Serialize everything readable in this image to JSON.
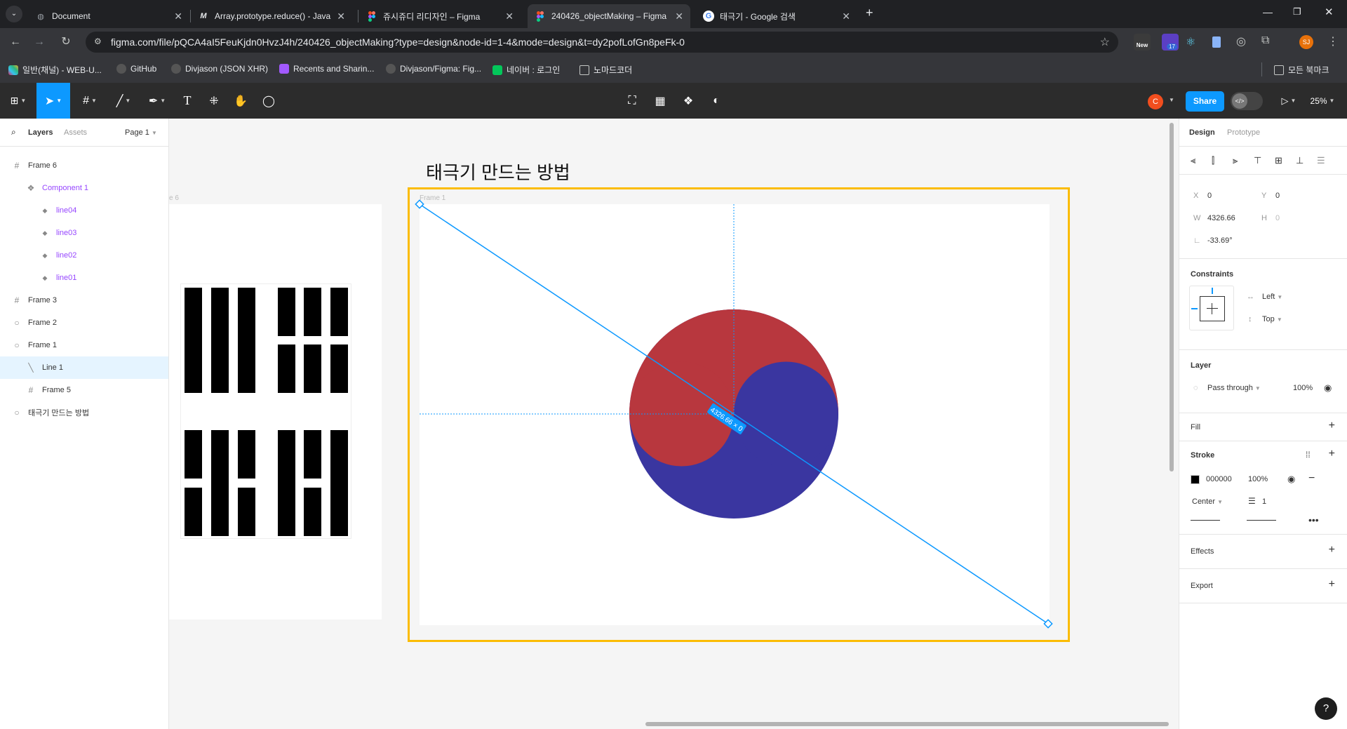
{
  "browser": {
    "tabs": [
      {
        "title": "Document",
        "icon": "globe-icon"
      },
      {
        "title": "Array.prototype.reduce() - Java",
        "icon": "mdn-icon"
      },
      {
        "title": "쥬시쥬디 리디자인 – Figma",
        "icon": "figma-icon"
      },
      {
        "title": "240426_objectMaking – Figma",
        "icon": "figma-icon"
      },
      {
        "title": "태극기 - Google 검색",
        "icon": "google-icon"
      }
    ],
    "new_tab": "+",
    "url": "figma.com/file/pQCA4aI5FeuKjdn0HvzJ4h/240426_objectMaking?type=design&node-id=1-4&mode=design&t=dy2pofLofGn8peFk-0",
    "bookmarks": [
      "일반(채널) - WEB-U...",
      "GitHub",
      "Divjason (JSON XHR)",
      "Recents and Sharin...",
      "Divjason/Figma: Fig...",
      "네이버 : 로그인",
      "노마드코더"
    ],
    "all_bookmarks": "모든 북마크",
    "ext_new": "New",
    "ext_badge": "17",
    "profile": "SJ"
  },
  "toolbar": {
    "avatar": "C",
    "share": "Share",
    "zoom": "25%"
  },
  "left_panel": {
    "tab_layers": "Layers",
    "tab_assets": "Assets",
    "page": "Page 1",
    "layers": [
      {
        "name": "Frame 6",
        "icon": "frame-icon",
        "indent": 0
      },
      {
        "name": "Component 1",
        "icon": "component-icon",
        "indent": 1
      },
      {
        "name": "line04",
        "icon": "instance-icon",
        "indent": 2
      },
      {
        "name": "line03",
        "icon": "instance-icon",
        "indent": 2
      },
      {
        "name": "line02",
        "icon": "instance-icon",
        "indent": 2
      },
      {
        "name": "line01",
        "icon": "instance-icon",
        "indent": 2
      },
      {
        "name": "Frame 3",
        "icon": "frame-icon",
        "indent": 0
      },
      {
        "name": "Frame 2",
        "icon": "ellipse-icon",
        "indent": 0
      },
      {
        "name": "Frame 1",
        "icon": "ellipse-icon",
        "indent": 0
      },
      {
        "name": "Line 1",
        "icon": "line-icon",
        "indent": 1
      },
      {
        "name": "Frame 5",
        "icon": "frame-icon",
        "indent": 1
      },
      {
        "name": "태극기 만드는 방법",
        "icon": "ellipse-icon",
        "indent": 0
      }
    ]
  },
  "canvas": {
    "heading": "태극기 만드는 방법",
    "frame1_label": "Frame 1",
    "frame6_label": "e 6",
    "measure": "4326.66 × 0",
    "colors": {
      "red": "#b8373e",
      "blue": "#3a36a0",
      "selection": "#fbbc04",
      "line": "#0d99ff"
    }
  },
  "right_panel": {
    "tab_design": "Design",
    "tab_prototype": "Prototype",
    "x_label": "X",
    "x_value": "0",
    "y_label": "Y",
    "y_value": "0",
    "w_label": "W",
    "w_value": "4326.66",
    "h_label": "H",
    "h_value": "0",
    "rotation": "-33.69°",
    "constraints": "Constraints",
    "constraint_h": "Left",
    "constraint_v": "Top",
    "layer": "Layer",
    "blend": "Pass through",
    "opacity": "100%",
    "fill": "Fill",
    "stroke": "Stroke",
    "stroke_color": "000000",
    "stroke_opacity": "100%",
    "stroke_align": "Center",
    "stroke_weight": "1",
    "effects": "Effects",
    "export": "Export"
  }
}
